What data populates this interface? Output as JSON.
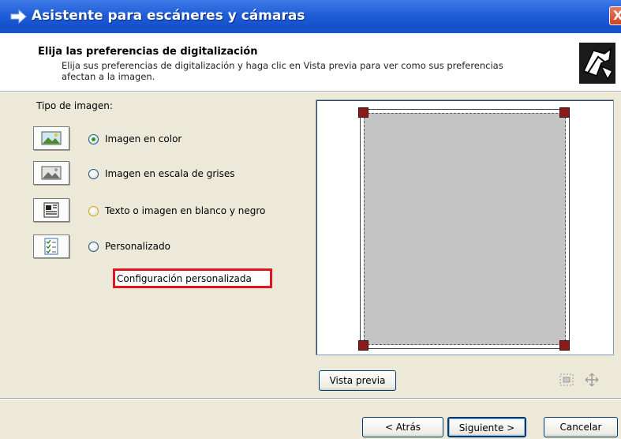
{
  "window": {
    "title": "Asistente para escáneres y cámaras",
    "close_label": "X"
  },
  "header": {
    "title": "Elija las preferencias de digitalización",
    "description": "Elija sus preferencias de digitalización y haga clic en Vista previa para ver como sus preferencias afectan a la imagen.",
    "icon": "scanner-wizard-icon"
  },
  "image_type": {
    "label": "Tipo de imagen:",
    "options": [
      {
        "label": "Imagen en color",
        "icon": "color-image-icon",
        "selected": true
      },
      {
        "label": "Imagen en escala de grises",
        "icon": "grayscale-image-icon",
        "selected": false
      },
      {
        "label": "Texto o imagen en blanco y negro",
        "icon": "bw-text-icon",
        "selected": false
      },
      {
        "label": "Personalizado",
        "icon": "custom-settings-icon",
        "selected": false
      }
    ],
    "custom_settings_label": "Configuración personalizada"
  },
  "preview": {
    "preview_button": "Vista previa",
    "tools": [
      "zoom-to-selection-icon",
      "fit-preview-icon"
    ]
  },
  "footer": {
    "back_label": "< Atrás",
    "next_label": "Siguiente >",
    "cancel_label": "Cancelar"
  },
  "colors": {
    "titlebar": "#1f5ed7",
    "dialog_bg": "#ece9d8",
    "highlight": "#e0141e",
    "scan_area": "#c4c4c4",
    "handle": "#8b1a1a"
  }
}
